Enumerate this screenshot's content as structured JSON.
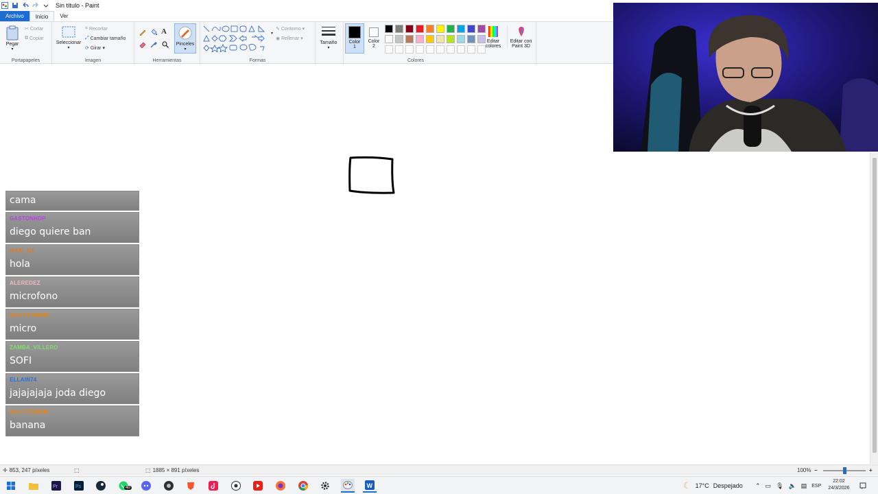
{
  "window": {
    "title": "Sin título - Paint"
  },
  "menu": {
    "file": "Archivo",
    "home": "Inicio",
    "view": "Ver"
  },
  "ribbon": {
    "clipboard": {
      "label": "Portapapeles",
      "paste": "Pegar",
      "cut": "Cortar",
      "copy": "Copiar"
    },
    "image": {
      "label": "Imagen",
      "select": "Seleccionar",
      "crop": "Recortar",
      "resize": "Cambiar tamaño",
      "rotate": "Girar"
    },
    "tools": {
      "label": "Herramientas",
      "brushes": "Pinceles"
    },
    "shapes": {
      "label": "Formas",
      "outline": "Contorno",
      "fill": "Rellenar"
    },
    "size": {
      "label": "Tamaño"
    },
    "colors": {
      "label": "Colores",
      "color1": "Color",
      "color1_num": "1",
      "color2": "Color",
      "color2_num": "2",
      "color1_value": "#000000",
      "color2_value": "#ffffff",
      "edit_colors": "Editar colores",
      "edit_paint3d": "Editar con Paint 3D",
      "palette_row1": [
        "#000000",
        "#7f7f7f",
        "#880015",
        "#ed1c24",
        "#ff7f27",
        "#fff200",
        "#22b14c",
        "#00a2e8",
        "#3f48cc",
        "#a349a4"
      ],
      "palette_row2": [
        "#ffffff",
        "#c3c3c3",
        "#b97a57",
        "#ffaec9",
        "#ffc90e",
        "#efe4b0",
        "#b5e61d",
        "#99d9ea",
        "#7092be",
        "#c8bfe7"
      ]
    }
  },
  "status": {
    "cursor_pos": "853, 247 píxeles",
    "canvas_size": "1885 × 891 píxeles",
    "zoom": "100%"
  },
  "chat": [
    {
      "user": "",
      "user_color": "#ffffff",
      "text": "cama"
    },
    {
      "user": "GASTONHDP",
      "user_color": "#b147d9",
      "text": "diego quiere ban"
    },
    {
      "user": "MAXI_C1",
      "user_color": "#e07a1f",
      "text": "hola"
    },
    {
      "user": "ALEREDEZ",
      "user_color": "#f3b6c6",
      "text": "microfono"
    },
    {
      "user": "BASTIRODRIG",
      "user_color": "#e0861f",
      "text": "micro"
    },
    {
      "user": "ZAMBA_VILLERO",
      "user_color": "#7ee06a",
      "text": "SOFI"
    },
    {
      "user": "ELLAIN74",
      "user_color": "#2f6ed6",
      "text": "jajajajaja joda diego"
    },
    {
      "user": "BASTIRODRIG",
      "user_color": "#e0861f",
      "text": "banana"
    }
  ],
  "taskbar": {
    "weather_temp": "17°C",
    "weather_text": "Despejado",
    "language": "ESP",
    "time": "22:02",
    "date": "24/3/2026",
    "whatsapp_badge": "40",
    "icons": [
      "windows-start",
      "file-explorer",
      "premiere-pro",
      "photoshop",
      "steam",
      "whatsapp",
      "discord",
      "obs",
      "brave",
      "tiktok",
      "obs-studio",
      "youtube-studio",
      "firefox",
      "chrome",
      "settings",
      "paint",
      "word"
    ]
  }
}
